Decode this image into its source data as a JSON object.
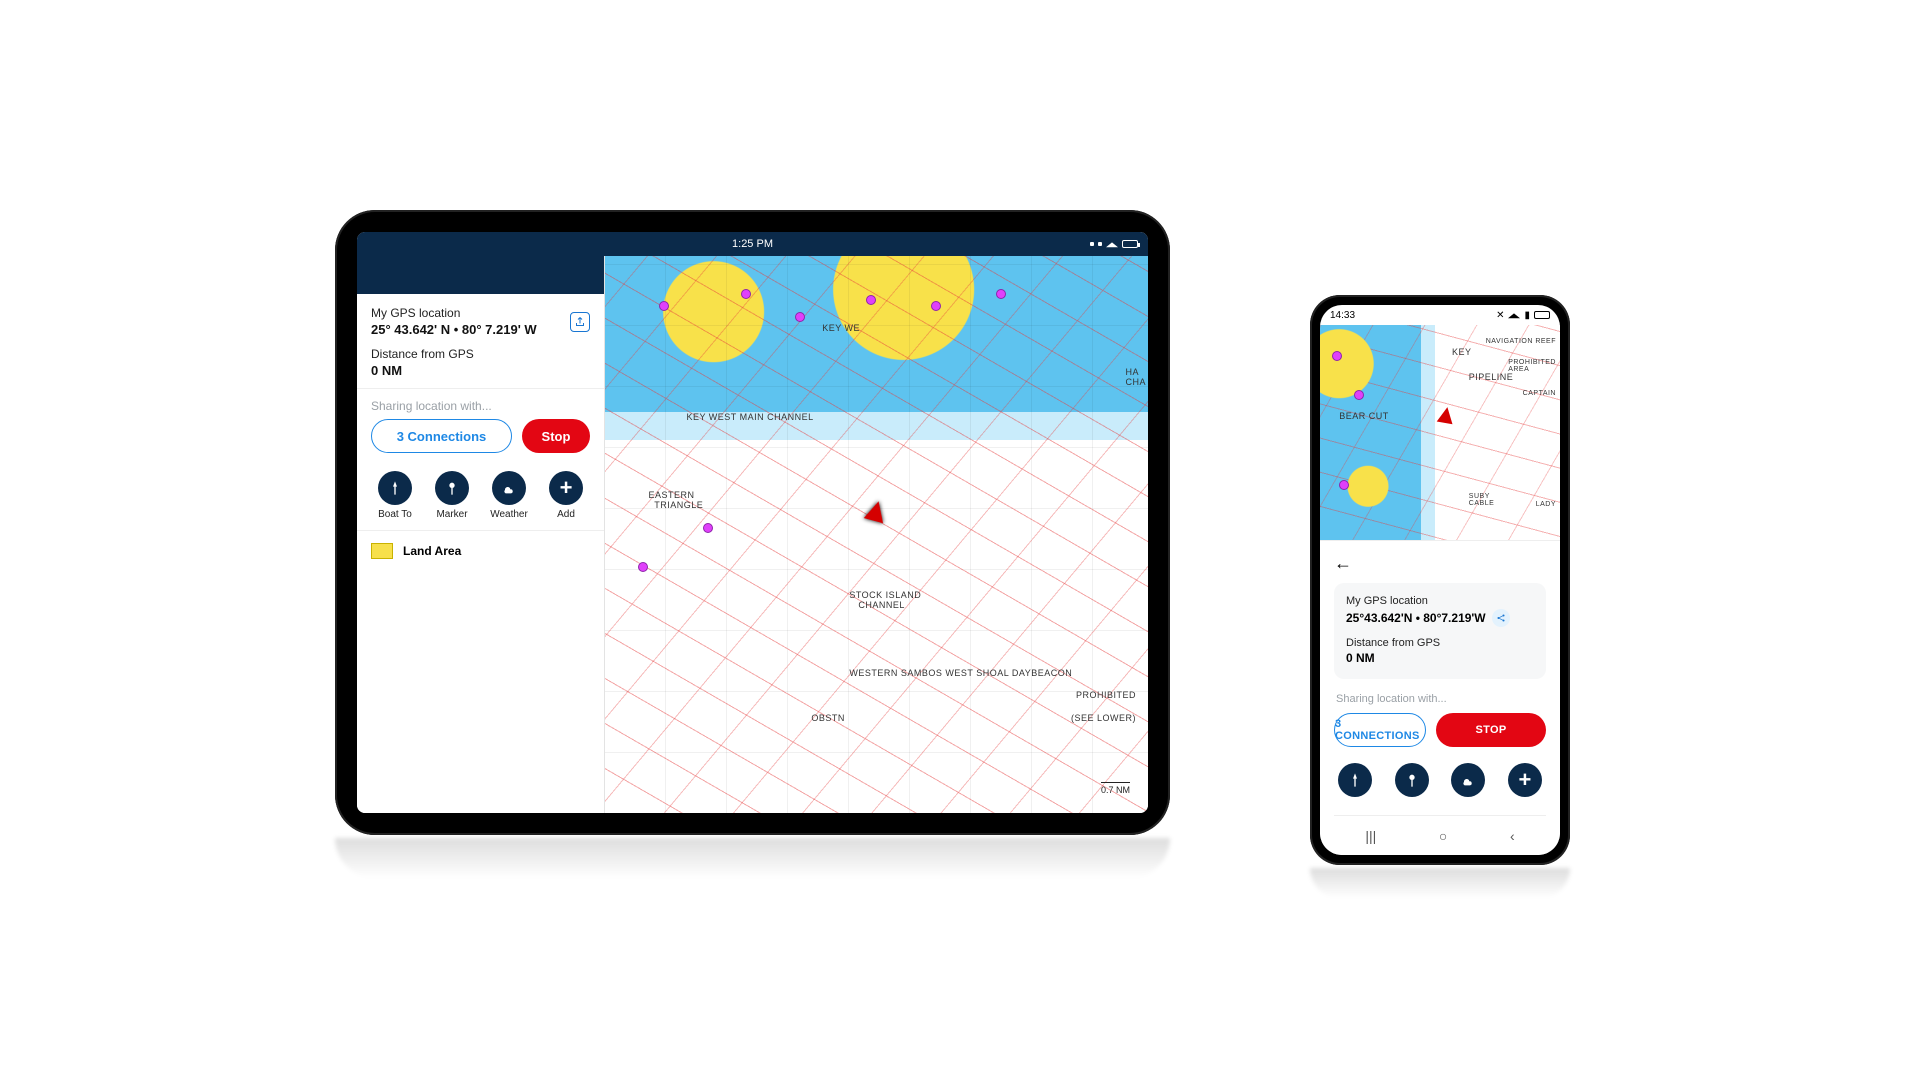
{
  "tablet": {
    "statusbar": {
      "time": "1:25 PM"
    },
    "gps": {
      "label": "My GPS location",
      "coords": "25° 43.642' N • 80° 7.219' W",
      "dist_label": "Distance from GPS",
      "dist_value": "0 NM"
    },
    "sharing_hint": "Sharing location with...",
    "connections_label": "3 Connections",
    "stop_label": "Stop",
    "quick": {
      "boat_to": "Boat To",
      "marker": "Marker",
      "weather": "Weather",
      "add": "Add"
    },
    "legend": {
      "land": "Land Area"
    },
    "map_labels": {
      "keywe": "KEY WE",
      "channel1": "KEY WEST MAIN CHANNEL",
      "eastern": "EASTERN\n  TRIANGLE",
      "stockisland": "STOCK ISLAND\n   CHANNEL",
      "obstn": "OBSTN",
      "western": "WESTERN SAMBOS WEST SHOAL DAYBEACON",
      "prohibited": "PROHIBITED",
      "seelower": "(SEE LOWER)",
      "edge_right": "HA\nCHA",
      "scale": "0.7    NM"
    }
  },
  "phone": {
    "statusbar": {
      "time": "14:33"
    },
    "gps": {
      "label": "My GPS location",
      "coords": "25°43.642'N • 80°7.219'W",
      "dist_label": "Distance from GPS",
      "dist_value": "0 NM"
    },
    "sharing_hint": "Sharing location with...",
    "connections_label": "3 CONNECTIONS",
    "stop_label": "STOP",
    "map_labels": {
      "key": "KEY",
      "bearcut": "BEAR CUT",
      "pipeline": "PIPELINE",
      "nav_reef": "NAVIGATION REEF",
      "prohibited": "PROHIBITED\nAREA",
      "captain": "CAPTAIN",
      "lady": "LADY",
      "suby": "SUBY\nCABLE"
    },
    "nav": {
      "recents": "|||",
      "home": "○",
      "back": "‹"
    }
  }
}
